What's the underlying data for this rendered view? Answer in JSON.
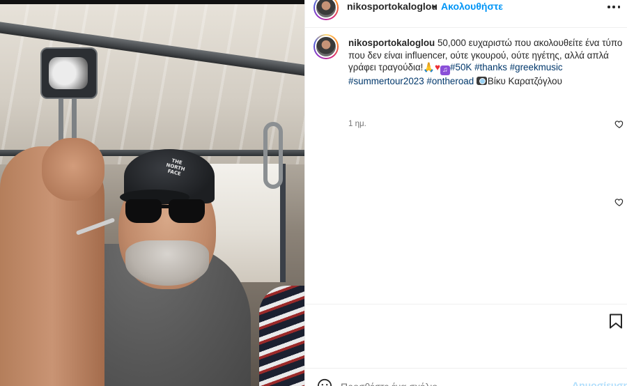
{
  "post": {
    "username": "nikosportokaloglou",
    "header_separator": "•",
    "follow_label": "Ακολουθήστε",
    "caption": {
      "text_line": "50,000 ευχαριστώ που ακολουθείτε ένα τύπο που δεν είναι influencer, ούτε γκουρού, ούτε ηγέτης, αλλά απλά γράφει τραγούδια!",
      "emojis": [
        "pray-emoji",
        "red-heart-emoji",
        "music-notes-emoji"
      ],
      "hashtags": [
        "#50K",
        "#thanks",
        "#greekmusic",
        "#summertour2023",
        "#ontheroad"
      ],
      "camera_emoji": "camera-emoji",
      "photo_credit": "Βίκυ Καρατζόγλου"
    },
    "time_ago": "1 ημ.",
    "cap_logo": "THE NORTH FACE"
  },
  "comment_bar": {
    "placeholder": "Προσθέστε ένα σχόλιο...",
    "post_label": "Δημοσίευση"
  },
  "colors": {
    "link_blue": "#0095f6",
    "hashtag_blue": "#00376b",
    "text": "#262626",
    "muted": "#737373",
    "divider": "#efefef"
  }
}
